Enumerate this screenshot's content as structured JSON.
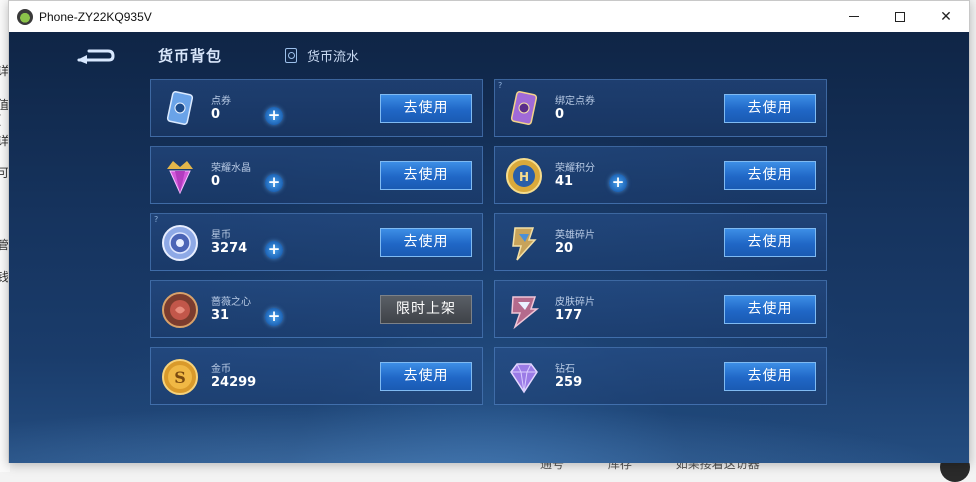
{
  "window": {
    "title": "Phone-ZY22KQ935V"
  },
  "header": {
    "title": "货币背包",
    "flow_label": "货币流水"
  },
  "currencies": [
    {
      "name": "点券",
      "value": "0",
      "button": "去使用",
      "has_plus": true
    },
    {
      "name": "绑定点券",
      "value": "0",
      "button": "去使用",
      "has_plus": false
    },
    {
      "name": "荣耀水晶",
      "value": "0",
      "button": "去使用",
      "has_plus": true
    },
    {
      "name": "荣耀积分",
      "value": "41",
      "button": "去使用",
      "has_plus": true
    },
    {
      "name": "星币",
      "value": "3274",
      "button": "去使用",
      "has_plus": true
    },
    {
      "name": "英雄碎片",
      "value": "20",
      "button": "去使用",
      "has_plus": false
    },
    {
      "name": "蔷薇之心",
      "value": "31",
      "button": "限时上架",
      "has_plus": true
    },
    {
      "name": "皮肤碎片",
      "value": "177",
      "button": "去使用",
      "has_plus": false
    },
    {
      "name": "金币",
      "value": "24299",
      "button": "去使用",
      "has_plus": false
    },
    {
      "name": "钻石",
      "value": "259",
      "button": "去使用",
      "has_plus": false
    }
  ],
  "plus_label": "+",
  "background": {
    "left_fragments": [
      "详",
      "值(",
      "详",
      "可",
      "管",
      "钱"
    ],
    "bottom_text": [
      "通号",
      "库存",
      "如果接着这访器"
    ]
  },
  "colors": {
    "accent": "#2067c6",
    "panel_bg": "#16345f"
  }
}
